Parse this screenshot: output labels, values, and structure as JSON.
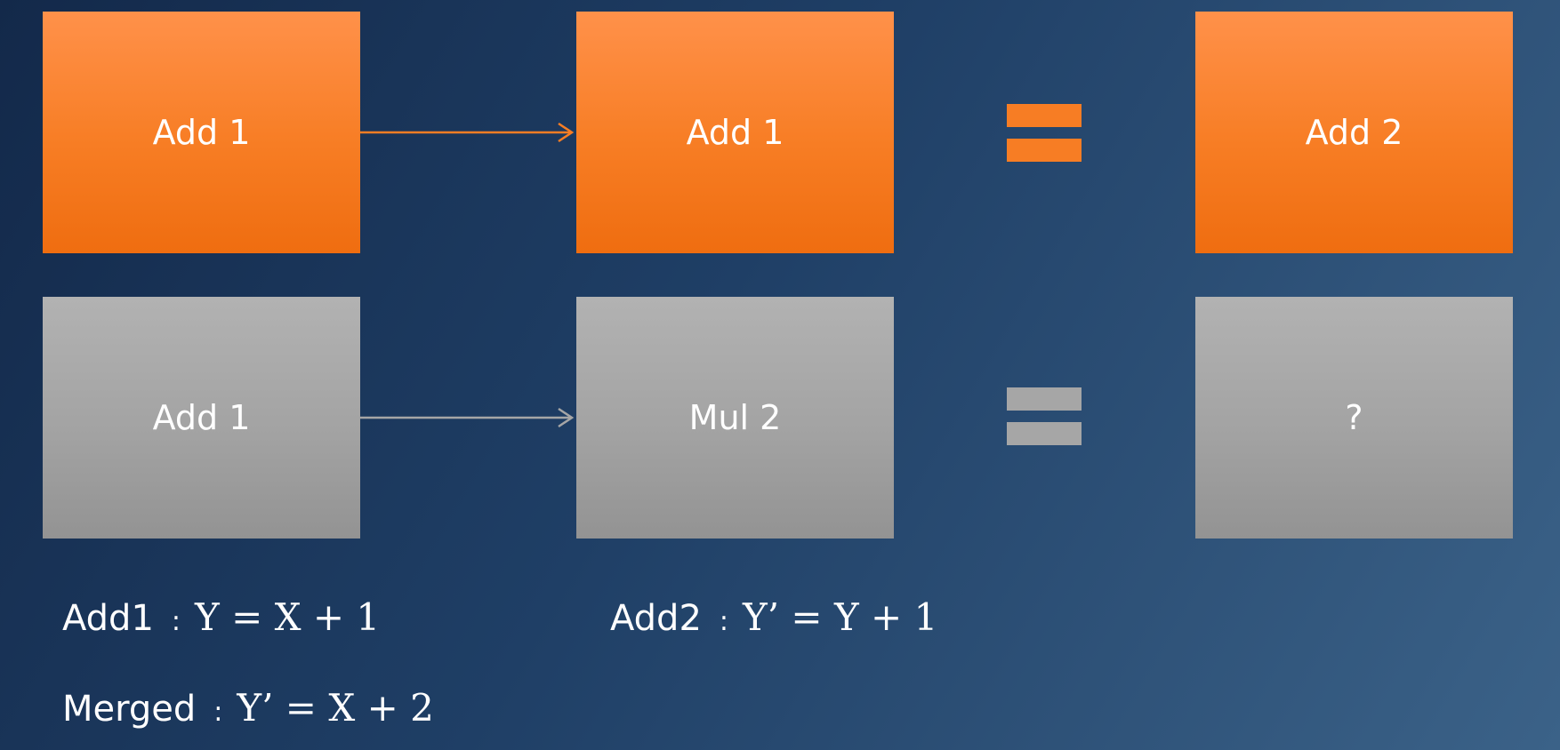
{
  "diagram": {
    "top_row": {
      "first_op": "Add 1",
      "second_op": "Add 1",
      "result": "Add 2"
    },
    "bottom_row": {
      "first_op": "Add 1",
      "second_op": "Mul 2",
      "result": "?"
    }
  },
  "formulas": {
    "add1": {
      "label": "Add1",
      "separator": ":",
      "expression": "Y = X + 1"
    },
    "add2": {
      "label": "Add2",
      "separator": ":",
      "expression": "Y’ = Y + 1"
    },
    "merged": {
      "label": "Merged",
      "separator": ":",
      "expression": "Y’ = X + 2"
    }
  },
  "colors": {
    "orange": "#f77d24",
    "gray": "#a6a6a6",
    "background_dark": "#13294a",
    "background_light": "#3b6288",
    "text": "#ffffff"
  }
}
